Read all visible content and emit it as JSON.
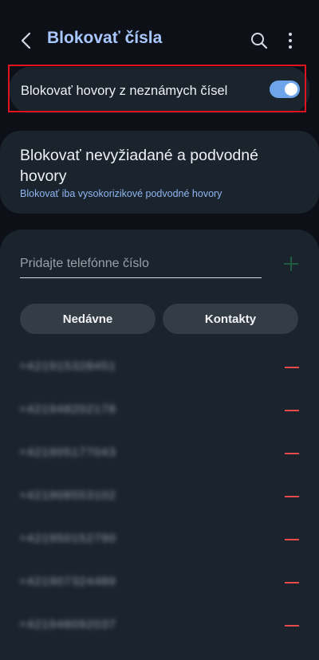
{
  "header": {
    "title": "Blokovať čísla"
  },
  "unknown_toggle": {
    "label": "Blokovať hovory z neznámych čísel",
    "enabled": true
  },
  "spam": {
    "title": "Blokovať nevyžiadané a podvodné hovory",
    "subtitle": "Blokovať iba vysokorizikové podvodné hovory"
  },
  "add_number": {
    "placeholder": "Pridajte telefónne číslo",
    "add_color": "#1f6b4a"
  },
  "buttons": {
    "recent": "Nedávne",
    "contacts": "Kontakty"
  },
  "blocked_numbers": [
    "+421915328451",
    "+421948202178",
    "+421905177043",
    "+421908553102",
    "+421950152790",
    "+421907324489",
    "+421948092037"
  ],
  "colors": {
    "accent": "#a9c7ff",
    "switch_on": "#6ea5ea",
    "remove": "#e84a4a",
    "highlight": "#e0141e"
  }
}
